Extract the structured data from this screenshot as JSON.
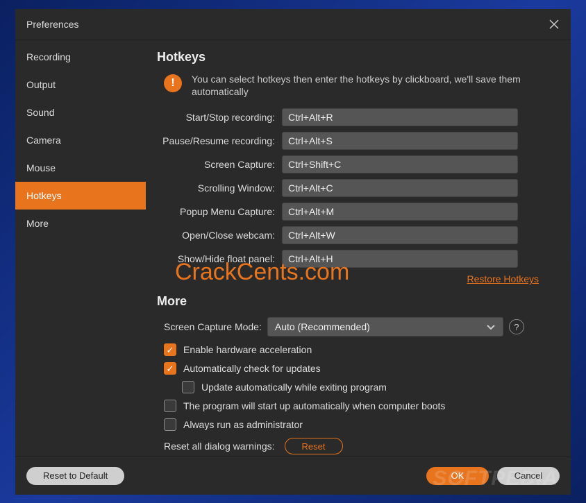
{
  "colors": {
    "accent": "#e8741e",
    "bg": "#2a2a2a",
    "input_bg": "#555"
  },
  "titlebar": {
    "title": "Preferences"
  },
  "sidebar": {
    "items": [
      {
        "label": "Recording"
      },
      {
        "label": "Output"
      },
      {
        "label": "Sound"
      },
      {
        "label": "Camera"
      },
      {
        "label": "Mouse"
      },
      {
        "label": "Hotkeys"
      },
      {
        "label": "More"
      }
    ]
  },
  "hotkeys_section": {
    "title": "Hotkeys",
    "info": "You can select hotkeys then enter the hotkeys by clickboard, we'll save them automatically",
    "fields": [
      {
        "label": "Start/Stop recording:",
        "value": "Ctrl+Alt+R"
      },
      {
        "label": "Pause/Resume recording:",
        "value": "Ctrl+Alt+S"
      },
      {
        "label": "Screen Capture:",
        "value": "Ctrl+Shift+C"
      },
      {
        "label": "Scrolling Window:",
        "value": "Ctrl+Alt+C"
      },
      {
        "label": "Popup Menu Capture:",
        "value": "Ctrl+Alt+M"
      },
      {
        "label": "Open/Close webcam:",
        "value": "Ctrl+Alt+W"
      },
      {
        "label": "Show/Hide float panel:",
        "value": "Ctrl+Alt+H"
      }
    ],
    "restore_label": "Restore Hotkeys"
  },
  "more_section": {
    "title": "More",
    "mode_label": "Screen Capture Mode:",
    "mode_value": "Auto (Recommended)",
    "checks": [
      {
        "label": "Enable hardware acceleration",
        "checked": true
      },
      {
        "label": "Automatically check for updates",
        "checked": true
      },
      {
        "label": "Update automatically while exiting program",
        "checked": false,
        "indent": true
      },
      {
        "label": "The program will start up automatically when computer boots",
        "checked": false
      },
      {
        "label": "Always run as administrator",
        "checked": false
      }
    ],
    "reset_warnings_label": "Reset all dialog warnings:",
    "reset_btn": "Reset"
  },
  "footer": {
    "reset_default": "Reset to Default",
    "ok": "OK",
    "cancel": "Cancel"
  },
  "watermarks": {
    "crack": "CrackCents.com",
    "softpedia": "SOFTPEDIA"
  }
}
